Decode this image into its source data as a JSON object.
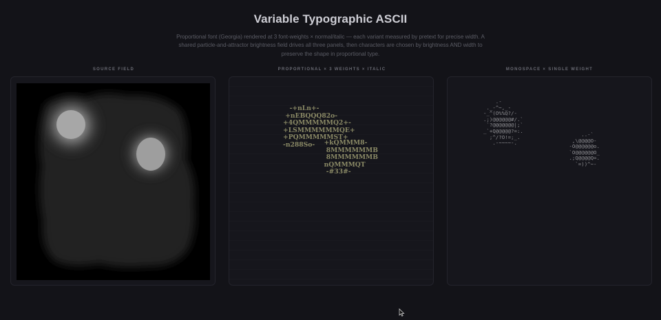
{
  "header": {
    "title": "Variable Typographic ASCII",
    "subtitle": "Proportional font (Georgia) rendered at 3 font-weights × normal/italic — each variant measured by pretext for precise width. A shared particle-and-attractor brightness field drives all three panels, then characters are chosen by brightness AND width to preserve the shape in proportional type."
  },
  "panels": {
    "source": {
      "label": "SOURCE FIELD"
    },
    "proportional": {
      "label": "PROPORTIONAL × 3 WEIGHTS × ITALIC",
      "ascii_a": "   -+nLn+-\n +nEBQQQ82o-\n+4QMMMMMQ2+-\n+LSMMMMMMQE+\n+PQMMMMMST+\n-n288So-",
      "ascii_b": "   +kQMMM8-\n    8MMMMMMB\n    8MMMMMMB\n   nQMMMQT\n    -#33#-"
    },
    "monospace": {
      "label": "MONOSPACE × SINGLE WEIGHT",
      "ascii_a": "    .-\n ._-^~,_-\n-_^(O%%Q?/-\n.;)@@@@@@#/.`\n `?@@@@@@@|;`\n_`+Q@@@@@?=:.\n  ;^/?O!=;_.\n   .-~~~~-.",
      "ascii_b": "     ..-`\n  ,\\@@@@O-\n -O@@@@@@o.\n `O@@@@@@O_\n .;Q@@@@Q=.\n   `=))^~-"
    }
  },
  "colors": {
    "background": "#131318",
    "panel": "#16161c",
    "accent_text": "#8b8a66"
  },
  "icons": {
    "cursor": "mouse-pointer-icon"
  }
}
